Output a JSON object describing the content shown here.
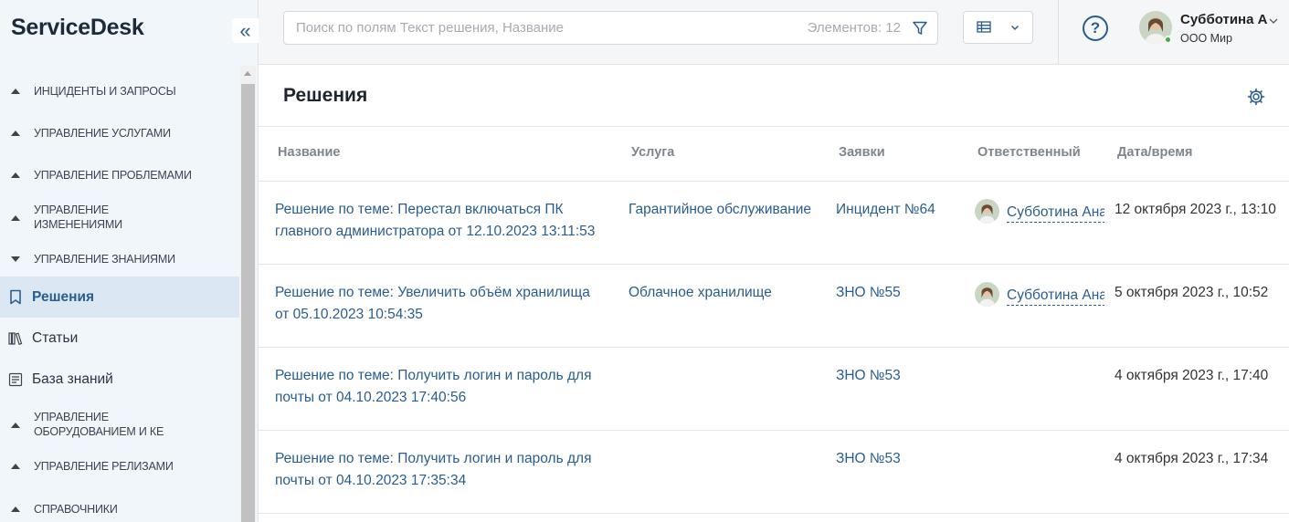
{
  "app": {
    "brand": "ServiceDesk",
    "collapse_icon": "«"
  },
  "sidebar": {
    "groups": [
      {
        "label": "ИНЦИДЕНТЫ И ЗАПРОСЫ",
        "state": "collapsed"
      },
      {
        "label": "УПРАВЛЕНИЕ УСЛУГАМИ",
        "state": "collapsed"
      },
      {
        "label": "УПРАВЛЕНИЕ ПРОБЛЕМАМИ",
        "state": "collapsed"
      },
      {
        "label": "УПРАВЛЕНИЕ ИЗМЕНЕНИЯМИ",
        "label_line1": "УПРАВЛЕНИЕ",
        "label_line2": "ИЗМЕНЕНИЯМИ",
        "state": "collapsed"
      },
      {
        "label": "УПРАВЛЕНИЕ ЗНАНИЯМИ",
        "state": "expanded"
      }
    ],
    "sub_items": [
      {
        "label": "Решения",
        "icon": "bookmark-icon",
        "active": true
      },
      {
        "label": "Статьи",
        "icon": "books-icon",
        "active": false
      },
      {
        "label": "База знаний",
        "icon": "knowledge-base-icon",
        "active": false
      }
    ],
    "groups_after": [
      {
        "label": "УПРАВЛЕНИЕ ОБОРУДОВАНИЕМ И КЕ",
        "label_line1": "УПРАВЛЕНИЕ",
        "label_line2": "ОБОРУДОВАНИЕМ И КЕ",
        "state": "collapsed"
      },
      {
        "label": "УПРАВЛЕНИЕ РЕЛИЗАМИ",
        "state": "collapsed"
      },
      {
        "label": "СПРАВОЧНИКИ",
        "state": "collapsed"
      }
    ]
  },
  "header": {
    "search_placeholder": "Поиск по полям Текст решения, Название",
    "items_count": "Элементов: 12",
    "help_label": "?",
    "user": {
      "name": "Субботина А",
      "org": "ООО Мир",
      "status": "online"
    }
  },
  "main": {
    "title": "Решения",
    "columns": [
      "Название",
      "Услуга",
      "Заявки",
      "Ответственный",
      "Дата/время"
    ],
    "rows": [
      {
        "name_line1": "Решение по теме: Перестал включаться ПК",
        "name_line2": "главного администратора от 12.10.2023 13:11:53",
        "service": "Гарантийное обслуживание",
        "request": "Инцидент №64",
        "responsible": "Субботина Анастасия",
        "datetime": "12 октября 2023 г., 13:10"
      },
      {
        "name_line1": "Решение по теме: Увеличить объём хранилища",
        "name_line2": "от 05.10.2023 10:54:35",
        "service": "Облачное хранилище",
        "request": "ЗНО №55",
        "responsible": "Субботина Анастасия",
        "datetime": "5 октября 2023 г., 10:52"
      },
      {
        "name_line1": "Решение по теме: Получить логин и пароль для",
        "name_line2": "почты от 04.10.2023 17:40:56",
        "service": "",
        "request": "ЗНО №53",
        "responsible": "",
        "datetime": "4 октября 2023 г., 17:40"
      },
      {
        "name_line1": "Решение по теме: Получить логин и пароль для",
        "name_line2": "почты от 04.10.2023 17:35:34",
        "service": "",
        "request": "ЗНО №53",
        "responsible": "",
        "datetime": "4 октября 2023 г., 17:34"
      }
    ]
  },
  "colors": {
    "accent": "#2a5d8f",
    "sidebar_bg": "#f1f6fb",
    "active_bg": "#dbe8f3",
    "online": "#3bb14a"
  }
}
